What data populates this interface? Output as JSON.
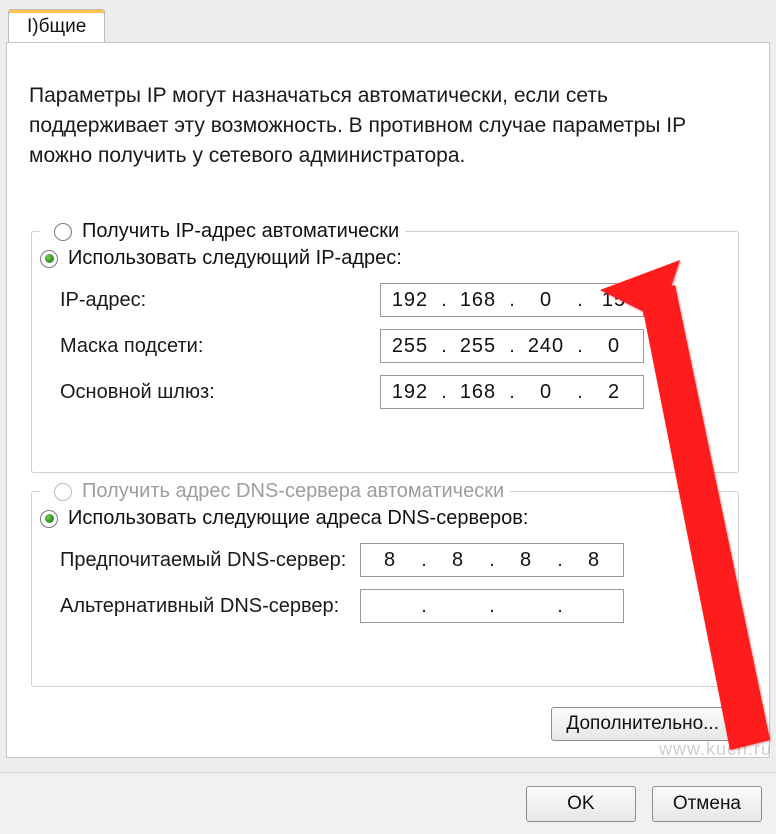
{
  "tab": {
    "label": "I)бщие"
  },
  "description": "Параметры IP могут назначаться автоматически, если сеть поддерживает эту возможность. В противном случае параметры IP можно получить у сетевого администратора.",
  "ip_group": {
    "radio_auto": "Получить IP-адрес автоматически",
    "radio_manual": "Использовать следующий IP-адрес:",
    "rows": {
      "ip": {
        "label": "IP-адрес:",
        "oct": [
          "192",
          "168",
          "0",
          "15"
        ]
      },
      "mask": {
        "label": "Маска подсети:",
        "oct": [
          "255",
          "255",
          "240",
          "0"
        ]
      },
      "gw": {
        "label": "Основной шлюз:",
        "oct": [
          "192",
          "168",
          "0",
          "2"
        ]
      }
    }
  },
  "dns_group": {
    "radio_auto": "Получить адрес DNS-сервера автоматически",
    "radio_manual": "Использовать следующие адреса DNS-серверов:",
    "rows": {
      "pref": {
        "label": "Предпочитаемый DNS-сервер:",
        "oct": [
          "8",
          "8",
          "8",
          "8"
        ]
      },
      "alt": {
        "label": "Альтернативный DNS-сервер:",
        "oct": [
          "",
          "",
          "",
          ""
        ]
      }
    }
  },
  "buttons": {
    "advanced": "Дополнительно...",
    "ok": "OK",
    "cancel": "Отмена"
  },
  "watermark": "www.kuch.ru"
}
